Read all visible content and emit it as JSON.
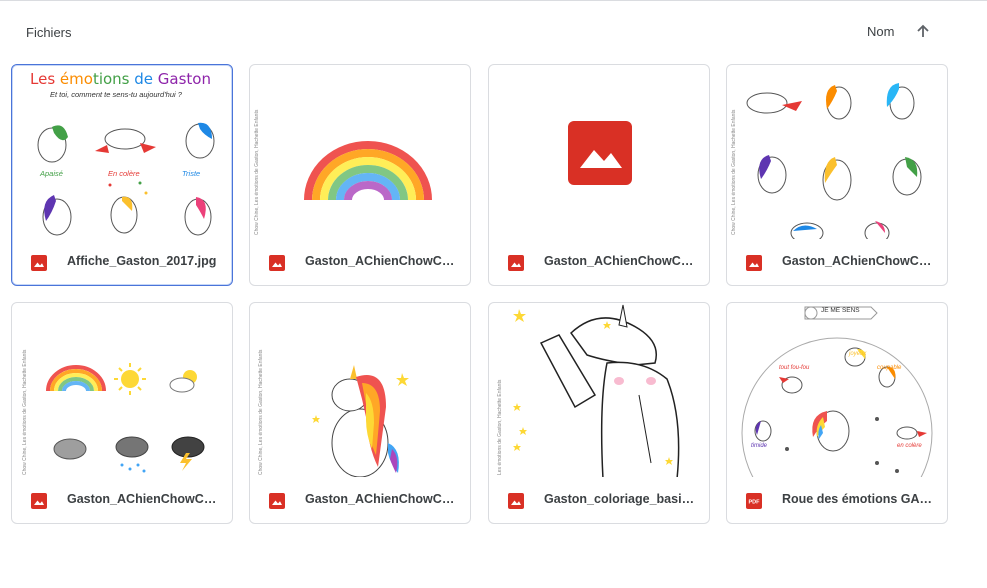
{
  "header": {
    "section_title": "Fichiers",
    "sort_label": "Nom",
    "sort_icon": "arrow-up-icon"
  },
  "colors": {
    "image_red": "#d93025",
    "selected_border": "#4a74d9",
    "card_border": "#dadce0"
  },
  "files": [
    {
      "name": "Affiche_Gaston_2017.jpg",
      "type": "image",
      "selected": true,
      "thumbnail": {
        "title": "Les émotions de Gaston",
        "subtitle": "Et toi, comment te sens-tu aujourd'hui ?",
        "labels": [
          "Apaisé",
          "En colère",
          "Triste"
        ]
      }
    },
    {
      "name": "Gaston_AChienChowChi…",
      "type": "image",
      "thumbnail": {
        "credit": "Chow Chine, Les émotions de Gaston, Hachette Enfants"
      }
    },
    {
      "name": "Gaston_AChienChowChi…",
      "type": "image"
    },
    {
      "name": "Gaston_AChienChowChi…",
      "type": "image",
      "thumbnail": {
        "credit": "Chow Chine, Les émotions de Gaston, Hachette Enfants"
      }
    },
    {
      "name": "Gaston_AChienChowChi…",
      "type": "image",
      "thumbnail": {
        "credit": "Chow Chine, Les émotions de Gaston, Hachette Enfants"
      }
    },
    {
      "name": "Gaston_AChienChowChi…",
      "type": "image",
      "thumbnail": {
        "credit": "Chow Chine, Les émotions de Gaston, Hachette Enfants"
      }
    },
    {
      "name": "Gaston_coloriage_basiq…",
      "type": "image",
      "thumbnail": {
        "credit": "Les émotions de Gaston, Hachette Enfants"
      }
    },
    {
      "name": "Roue des émotions GAS…",
      "type": "pdf",
      "icon_label": "PDF",
      "thumbnail": {
        "banner": "JE ME SENS",
        "labels": [
          "tout fou-fou",
          "joyeux",
          "coupable",
          "timide",
          "en colère"
        ]
      }
    }
  ]
}
